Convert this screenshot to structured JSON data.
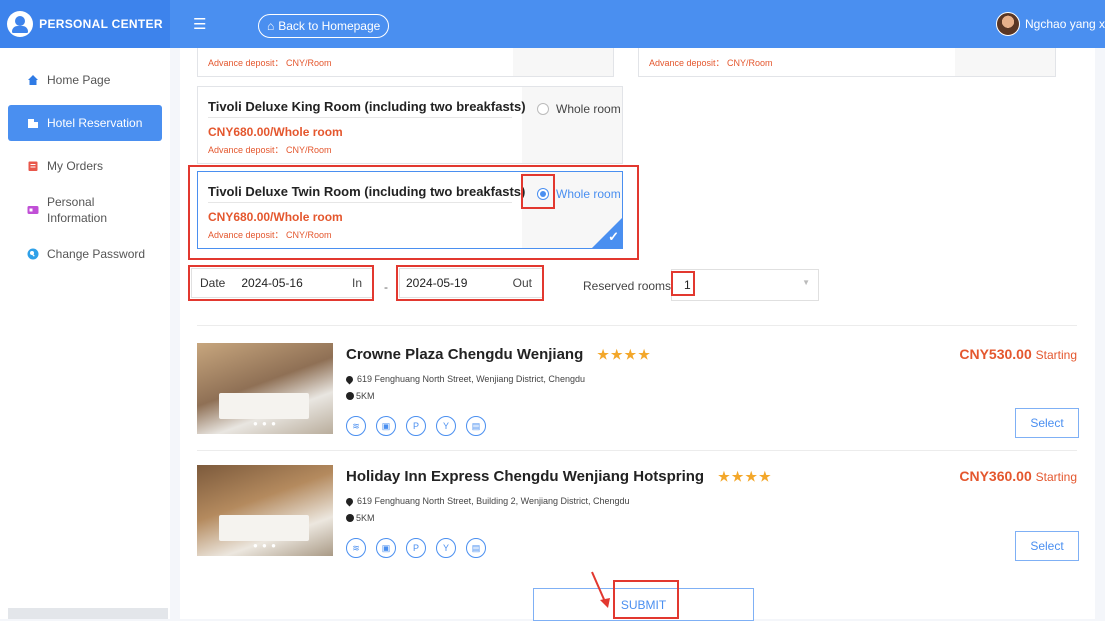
{
  "header": {
    "logo_text": "PERSONAL CENTER",
    "back_label": "Back to Homepage",
    "user_name": "Ngchao yang x l"
  },
  "sidebar": {
    "items": [
      {
        "label": "Home Page",
        "icon": "home-icon"
      },
      {
        "label": "Hotel Reservation",
        "icon": "hotel-icon",
        "active": true
      },
      {
        "label": "My Orders",
        "icon": "orders-icon"
      },
      {
        "label": "Personal Information",
        "icon": "id-card-icon"
      },
      {
        "label": "Change Password",
        "icon": "lock-icon"
      }
    ]
  },
  "rooms": {
    "top_left_deposit": "Advance deposit： CNY/Room",
    "top_right_deposit": "Advance deposit： CNY/Room",
    "king": {
      "name": "Tivoli Deluxe King Room  (including two breakfasts)",
      "price": "CNY680.00/Whole room",
      "deposit": "Advance deposit： CNY/Room",
      "option": "Whole room"
    },
    "twin": {
      "name": "Tivoli Deluxe Twin Room  (including two breakfasts)",
      "price": "CNY680.00/Whole room",
      "deposit": "Advance deposit： CNY/Room",
      "option": "Whole room",
      "selected": true
    }
  },
  "booking": {
    "date_label": "Date",
    "check_in": "2024-05-16",
    "in_label": "In",
    "separator": "-",
    "check_out": "2024-05-19",
    "out_label": "Out",
    "rooms_label": "Reserved rooms",
    "rooms_value": "1"
  },
  "hotels": [
    {
      "name": "Crowne Plaza Chengdu Wenjiang",
      "stars": "★★★★",
      "address": "619 Fenghuang North Street, Wenjiang District, Chengdu",
      "distance": "5KM",
      "price": "CNY530.00",
      "price_suffix": "Starting",
      "select_label": "Select"
    },
    {
      "name": "Holiday Inn Express Chengdu Wenjiang Hotspring",
      "stars": "★★★★",
      "address": "619 Fenghuang North Street, Building 2, Wenjiang District, Chengdu",
      "distance": "5KM",
      "price": "CNY360.00",
      "price_suffix": "Starting",
      "select_label": "Select"
    }
  ],
  "amenity_icons": [
    "wifi-icon",
    "computer-icon",
    "parking-icon",
    "dining-icon",
    "breakfast-icon"
  ],
  "submit_label": "SUBMIT",
  "colors": {
    "primary": "#4a8ff0",
    "price": "#e4572e",
    "highlight": "#e2382f",
    "star": "#f3a72a"
  }
}
